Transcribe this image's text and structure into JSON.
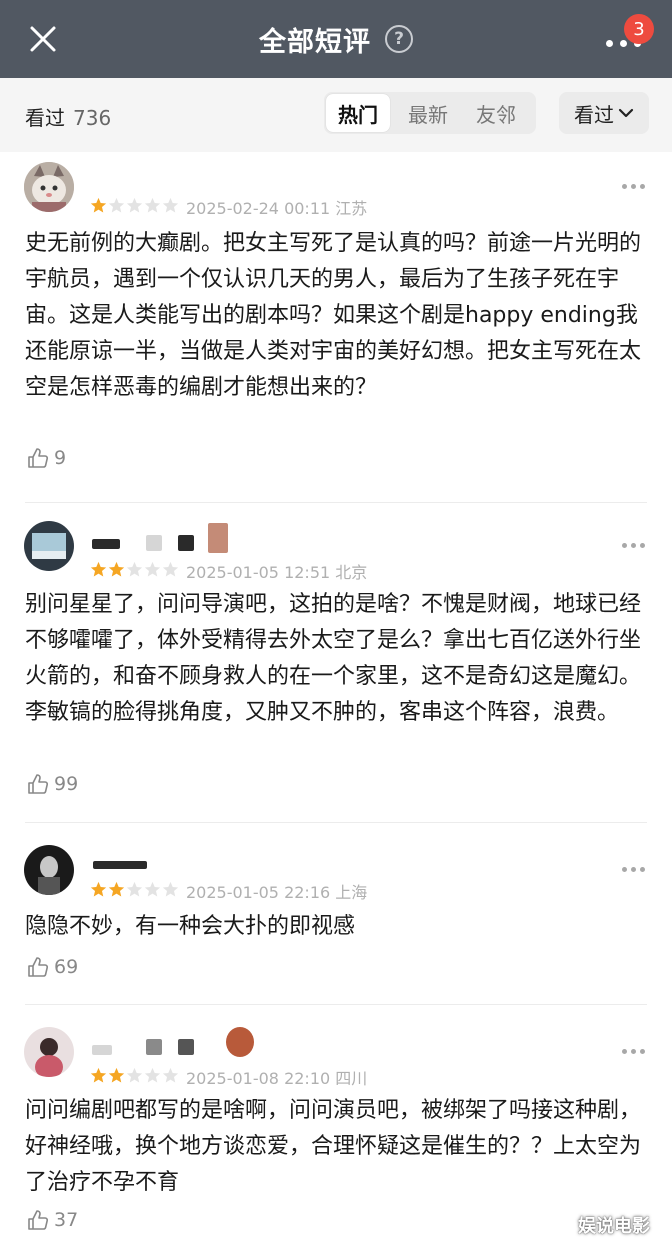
{
  "header": {
    "title": "全部短评",
    "help_glyph": "?",
    "badge_count": "3"
  },
  "filter": {
    "seen_label": "看过",
    "seen_count": "736",
    "tabs": [
      "热门",
      "最新",
      "友邻"
    ],
    "active_tab": "热门",
    "dropdown_label": "看过"
  },
  "reviews": [
    {
      "rating": 1,
      "date": "2025-02-24 00:11",
      "location": "江苏",
      "text": "史无前例的大癫剧。把女主写死了是认真的吗？前途一片光明的宇航员，遇到一个仅认识几天的男人，最后为了生孩子死在宇宙。这是人类能写出的剧本吗？如果这个剧是happy ending我还能原谅一半，当做是人类对宇宙的美好幻想。把女主写死在太空是怎样恶毒的编剧才能想出来的？",
      "likes": "9"
    },
    {
      "rating": 2,
      "date": "2025-01-05 12:51",
      "location": "北京",
      "text": "别问星星了，问问导演吧，这拍的是啥？不愧是财阀，地球已经不够嚯嚯了，体外受精得去外太空了是么？拿出七百亿送外行坐火箭的，和奋不顾身救人的在一个家里，这不是奇幻这是魔幻。李敏镐的脸得挑角度，又肿又不肿的，客串这个阵容，浪费。",
      "likes": "99"
    },
    {
      "rating": 2,
      "date": "2025-01-05 22:16",
      "location": "上海",
      "text": "隐隐不妙，有一种会大扑的即视感",
      "likes": "69"
    },
    {
      "rating": 2,
      "date": "2025-01-08 22:10",
      "location": "四川",
      "text": "问问编剧吧都写的是啥啊，问问演员吧，被绑架了吗接这种剧，好神经哦，换个地方谈恋爱，合理怀疑这是催生的？？上太空为了治疗不孕不育",
      "likes": "37"
    }
  ],
  "watermark": "娱说电影",
  "colors": {
    "topbar": "#515862",
    "badge": "#ee4b3f",
    "star_filled": "#f5a623",
    "star_empty": "#e3e3e3",
    "meta_text": "#b0b0b0"
  }
}
